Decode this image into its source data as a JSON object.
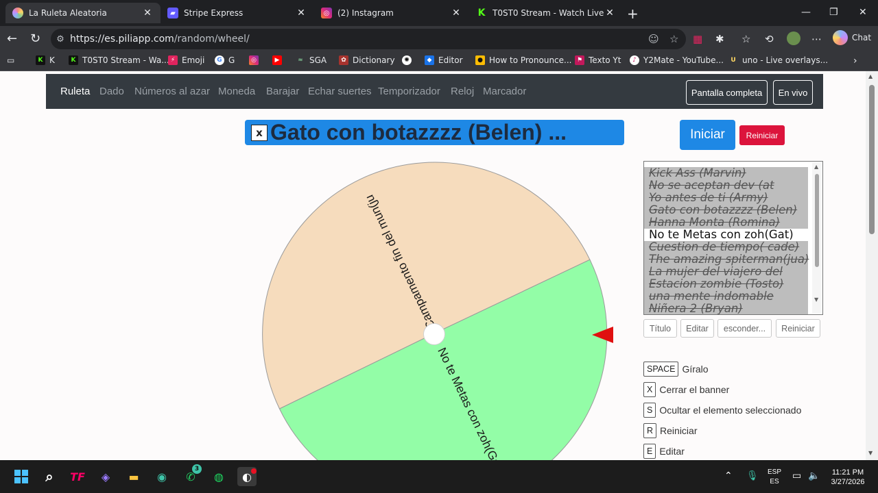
{
  "browser": {
    "tabs": [
      {
        "title": "La Ruleta Aleatoria",
        "active": true
      },
      {
        "title": "Stripe Express",
        "active": false
      },
      {
        "title": "(2) Instagram",
        "active": false
      },
      {
        "title": "T0ST0 Stream - Watch Live on Kick",
        "active": false
      }
    ],
    "url_host": "https://es.piliapp.com",
    "url_path": "/random/wheel/",
    "chat_label": "Chat",
    "bookmarks": [
      "K",
      "T0ST0 Stream - Wa...",
      "Emoji",
      "G",
      "SGA",
      "Dictionary",
      "Editor",
      "How to Pronounce...",
      "Texto Yt",
      "Y2Mate - YouTube...",
      "uno - Live overlays..."
    ]
  },
  "site": {
    "nav": [
      "Ruleta",
      "Dado",
      "Números al azar",
      "Moneda",
      "Barajar",
      "Echar suertes",
      "Temporizador",
      "Reloj",
      "Marcador"
    ],
    "active_nav": "Ruleta",
    "fullscreen_label": "Pantalla completa",
    "live_label": "En vivo"
  },
  "banner": {
    "close_label": "x",
    "text": "Gato con botazzzz (Belen) ..."
  },
  "controls": {
    "start_label": "Iniciar",
    "reset_label": "Reiniciar"
  },
  "wheel": {
    "segments": [
      {
        "label": "Campamento fin del mun(ju",
        "color": "#f6dcbd"
      },
      {
        "label": "No te Metas con zoh(Gat)",
        "color": "#93fda7"
      }
    ],
    "pointer_color": "#e01010"
  },
  "list": {
    "items": [
      {
        "text": "Kick Ass (Marvin)",
        "hidden": true
      },
      {
        "text": "No se aceptan dev (at",
        "hidden": true
      },
      {
        "text": "Yo antes de ti (Army)",
        "hidden": true
      },
      {
        "text": "Gato con botazzzz (Belen)",
        "hidden": true
      },
      {
        "text": "Hanna Monta (Romina)",
        "hidden": true
      },
      {
        "text": "No te Metas con zoh(Gat)",
        "hidden": false
      },
      {
        "text": "Cuestion de tiempo( cade)",
        "hidden": true
      },
      {
        "text": "The amazing spiterman(jua)",
        "hidden": true
      },
      {
        "text": "La mujer del viajero del",
        "hidden": true
      },
      {
        "text": "Estacion zombie (Tosto)",
        "hidden": true
      },
      {
        "text": "una mente indomable",
        "hidden": true
      },
      {
        "text": "Niñera 2 (Bryan)",
        "hidden": true
      }
    ],
    "buttons": [
      "Título",
      "Editar",
      "esconder...",
      "Reiniciar"
    ]
  },
  "shortcuts": [
    {
      "key": "SPACE",
      "desc": "Gíralo"
    },
    {
      "key": "X",
      "desc": "Cerrar el banner"
    },
    {
      "key": "S",
      "desc": "Ocultar el elemento seleccionado"
    },
    {
      "key": "R",
      "desc": "Reiniciar"
    },
    {
      "key": "E",
      "desc": "Editar"
    }
  ],
  "taskbar": {
    "whatsapp_badge": "3",
    "lang_top": "ESP",
    "lang_bottom": "ES",
    "time": "11:21 PM",
    "date": "3/27/2026"
  }
}
